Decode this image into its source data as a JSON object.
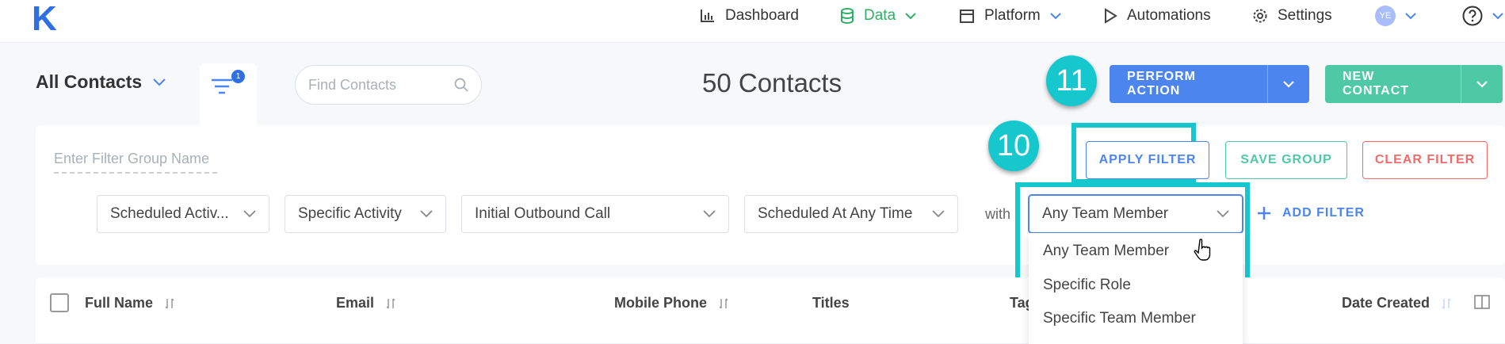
{
  "nav": {
    "logo": "K",
    "dashboard": "Dashboard",
    "data": "Data",
    "platform": "Platform",
    "automations": "Automations",
    "settings": "Settings",
    "avatar_initials": "YE"
  },
  "header": {
    "title": "All Contacts",
    "filter_badge_count": "1",
    "search_placeholder": "Find Contacts",
    "contact_count": "50 Contacts",
    "perform_action": "PERFORM ACTION",
    "new_contact": "NEW CONTACT"
  },
  "callouts": {
    "step_11": "11",
    "step_10": "10"
  },
  "filter_panel": {
    "group_name_placeholder": "Enter Filter Group Name",
    "apply_filter": "APPLY FILTER",
    "save_group": "SAVE GROUP",
    "clear_filter": "CLEAR FILTER",
    "selects": [
      {
        "value": "Scheduled Activ..."
      },
      {
        "value": "Specific Activity"
      },
      {
        "value": "Initial Outbound Call"
      },
      {
        "value": "Scheduled At Any Time"
      }
    ],
    "with_label": "with",
    "team_select_value": "Any Team Member",
    "add_filter": "ADD FILTER",
    "dropdown_options": [
      "Any Team Member",
      "Specific Role",
      "Specific Team Member"
    ]
  },
  "table": {
    "columns": [
      "Full Name",
      "Email",
      "Mobile Phone",
      "Titles",
      "Tag",
      "Date Created"
    ]
  },
  "colors": {
    "primary_blue": "#4c85ee",
    "green_accent": "#4fc9a5",
    "nav_active_green": "#2eaf64",
    "callout_teal": "#16c7ce",
    "clear_red": "#f06a6a"
  }
}
